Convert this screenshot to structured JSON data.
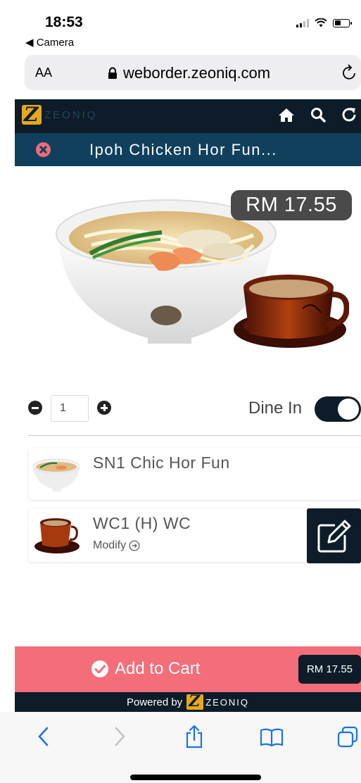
{
  "status_bar": {
    "time": "18:53",
    "back_label": "◀ Camera",
    "battery_level": 0.45
  },
  "browser": {
    "text_size_label": "AA",
    "url": "weborder.zeoniq.com"
  },
  "header": {
    "brand": "ZEONIQ",
    "logo_letter": "Z"
  },
  "title_bar": {
    "title": "Ipoh Chicken Hor Fun..."
  },
  "product": {
    "price": "RM 17.55"
  },
  "quantity": {
    "value": "1"
  },
  "dine_in": {
    "label": "Dine In",
    "enabled": true
  },
  "items": [
    {
      "name": "SN1 Chic Hor Fun"
    },
    {
      "name": "WC1 (H) WC",
      "modify_label": "Modify"
    }
  ],
  "cart": {
    "label": "Add to Cart",
    "total": "RM 17.55"
  },
  "footer": {
    "powered_label": "Powered by",
    "brand": "ZEONIQ"
  },
  "colors": {
    "header_bg": "#0d1c28",
    "title_bg": "#10405e",
    "accent_pink": "#f46e7a",
    "brand_gold": "#e5a91c"
  },
  "icons": {
    "status": [
      "signal-icon",
      "wifi-icon",
      "battery-icon"
    ],
    "header": [
      "home-icon",
      "search-icon",
      "refresh-icon"
    ],
    "toolbar": [
      "back-icon",
      "forward-icon",
      "share-icon",
      "bookmarks-icon",
      "tabs-icon"
    ]
  }
}
